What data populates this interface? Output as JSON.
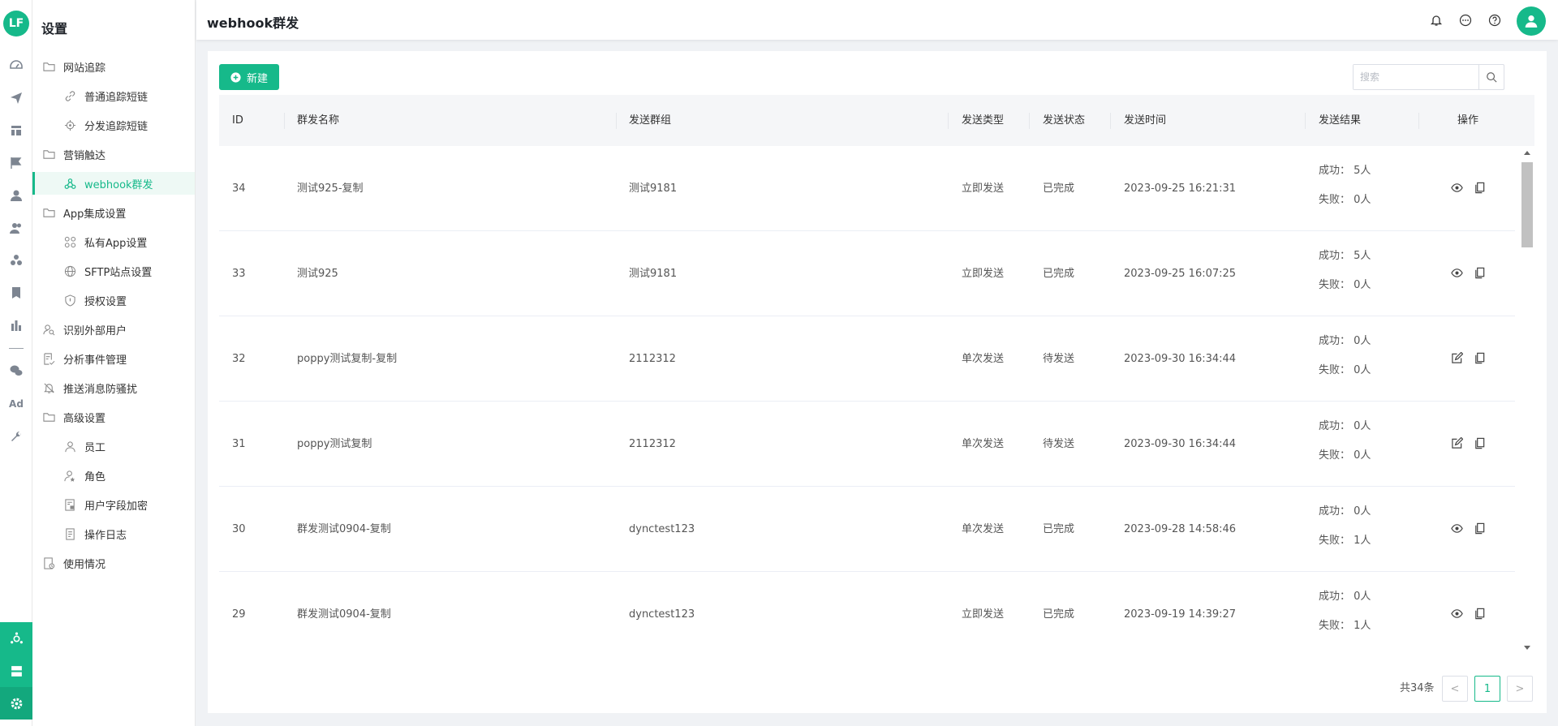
{
  "rail": {
    "logo": "LF",
    "icons": [
      "dashboard-icon",
      "send-icon",
      "layout-icon",
      "flag-icon",
      "user-icon",
      "users-icon",
      "group-icon",
      "bookmark-icon",
      "bar-chart-icon",
      "wechat-icon",
      "ad-icon",
      "wrench-icon"
    ],
    "ad_label": "Ad",
    "bottom_icons": [
      "hub-icon",
      "server-icon",
      "settings-icon"
    ]
  },
  "menu": {
    "title": "设置",
    "items": [
      {
        "label": "网站追踪",
        "level": 1,
        "icon": "folder-icon"
      },
      {
        "label": "普通追踪短链",
        "level": 2,
        "icon": "link-icon"
      },
      {
        "label": "分发追踪短链",
        "level": 2,
        "icon": "target-icon"
      },
      {
        "label": "营销触达",
        "level": 1,
        "icon": "folder-icon"
      },
      {
        "label": "webhook群发",
        "level": 2,
        "icon": "webhook-icon",
        "active": true
      },
      {
        "label": "App集成设置",
        "level": 1,
        "icon": "folder-icon"
      },
      {
        "label": "私有App设置",
        "level": 2,
        "icon": "apps-icon"
      },
      {
        "label": "SFTP站点设置",
        "level": 2,
        "icon": "globe-icon"
      },
      {
        "label": "授权设置",
        "level": 2,
        "icon": "shield-icon"
      },
      {
        "label": "识别外部用户",
        "level": 1,
        "icon": "user-search-icon"
      },
      {
        "label": "分析事件管理",
        "level": 1,
        "icon": "event-icon"
      },
      {
        "label": "推送消息防骚扰",
        "level": 1,
        "icon": "bell-off-icon"
      },
      {
        "label": "高级设置",
        "level": 1,
        "icon": "folder-icon"
      },
      {
        "label": "员工",
        "level": 2,
        "icon": "person-icon"
      },
      {
        "label": "角色",
        "level": 2,
        "icon": "role-icon"
      },
      {
        "label": "用户字段加密",
        "level": 2,
        "icon": "encrypt-icon"
      },
      {
        "label": "操作日志",
        "level": 2,
        "icon": "log-icon"
      },
      {
        "label": "使用情况",
        "level": 1,
        "icon": "usage-icon"
      }
    ]
  },
  "header": {
    "title": "webhook群发"
  },
  "toolbar": {
    "new_label": "新建",
    "search_placeholder": "搜索"
  },
  "table": {
    "columns": [
      "ID",
      "群发名称",
      "发送群组",
      "发送类型",
      "发送状态",
      "发送时间",
      "发送结果",
      "操作"
    ],
    "rows": [
      {
        "id": "34",
        "name": "测试925-复制",
        "group": "测试9181",
        "type": "立即发送",
        "status": "已完成",
        "time": "2023-09-25 16:21:31",
        "success": "成功：  5人",
        "fail": "失败：  0人",
        "ops": [
          "view",
          "copy"
        ]
      },
      {
        "id": "33",
        "name": "测试925",
        "group": "测试9181",
        "type": "立即发送",
        "status": "已完成",
        "time": "2023-09-25 16:07:25",
        "success": "成功：  5人",
        "fail": "失败：  0人",
        "ops": [
          "view",
          "copy"
        ]
      },
      {
        "id": "32",
        "name": "poppy测试复制-复制",
        "group": "2112312",
        "type": "单次发送",
        "status": "待发送",
        "time": "2023-09-30 16:34:44",
        "success": "成功：  0人",
        "fail": "失败：  0人",
        "ops": [
          "edit",
          "copy"
        ]
      },
      {
        "id": "31",
        "name": "poppy测试复制",
        "group": "2112312",
        "type": "单次发送",
        "status": "待发送",
        "time": "2023-09-30 16:34:44",
        "success": "成功：  0人",
        "fail": "失败：  0人",
        "ops": [
          "edit",
          "copy"
        ]
      },
      {
        "id": "30",
        "name": "群发测试0904-复制",
        "group": "dynctest123",
        "type": "单次发送",
        "status": "已完成",
        "time": "2023-09-28 14:58:46",
        "success": "成功：  0人",
        "fail": "失败：  1人",
        "ops": [
          "view",
          "copy"
        ]
      },
      {
        "id": "29",
        "name": "群发测试0904-复制",
        "group": "dynctest123",
        "type": "立即发送",
        "status": "已完成",
        "time": "2023-09-19 14:39:27",
        "success": "成功：  0人",
        "fail": "失败：  1人",
        "ops": [
          "view",
          "copy"
        ]
      }
    ]
  },
  "pagination": {
    "total": "共34条",
    "prev": "<",
    "current": "1",
    "next": ">"
  },
  "colors": {
    "accent": "#16b98a"
  }
}
